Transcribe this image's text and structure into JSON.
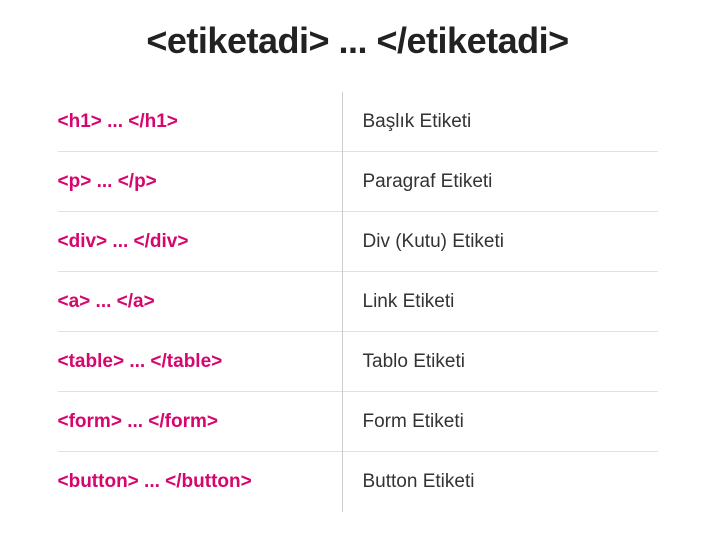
{
  "header": "<etiketadi>  ... </etiketadi>",
  "rows": [
    {
      "code": "<h1> ... </h1>",
      "desc": "Başlık Etiketi"
    },
    {
      "code": "<p> ... </p>",
      "desc": "Paragraf Etiketi"
    },
    {
      "code": "<div> ... </div>",
      "desc": "Div (Kutu) Etiketi"
    },
    {
      "code": "<a> ... </a>",
      "desc": "Link Etiketi"
    },
    {
      "code": "<table> ... </table>",
      "desc": "Tablo Etiketi"
    },
    {
      "code": "<form> ... </form>",
      "desc": "Form Etiketi"
    },
    {
      "code": "<button> ... </button>",
      "desc": "Button Etiketi"
    }
  ]
}
